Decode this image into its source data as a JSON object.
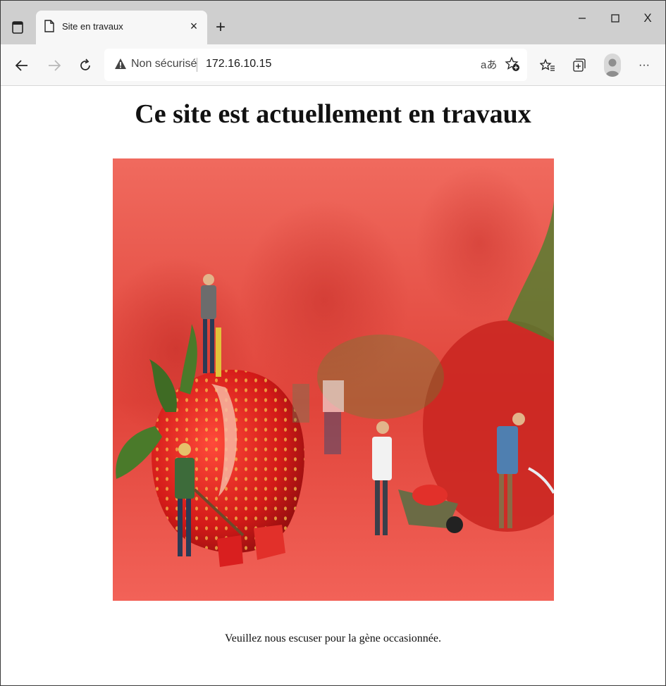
{
  "browser": {
    "tab": {
      "title": "Site en travaux",
      "close_glyph": "×"
    },
    "new_tab_glyph": "+",
    "window_controls": {
      "close_glyph": "X"
    },
    "address_bar": {
      "security_label": "Non sécurisé",
      "url": "172.16.10.15",
      "read_aloud_glyph": "aあ"
    },
    "more_glyph": "···"
  },
  "page": {
    "heading": "Ce site est actuellement en travaux",
    "caption": "Veuillez nous escuser pour la gène occasionnée.",
    "hero_image": {
      "icon": "strawberry-construction-photo",
      "colors": {
        "background": "#e8453c",
        "berry": "#d91f1f",
        "leaf": "#4a7a2a"
      }
    }
  }
}
